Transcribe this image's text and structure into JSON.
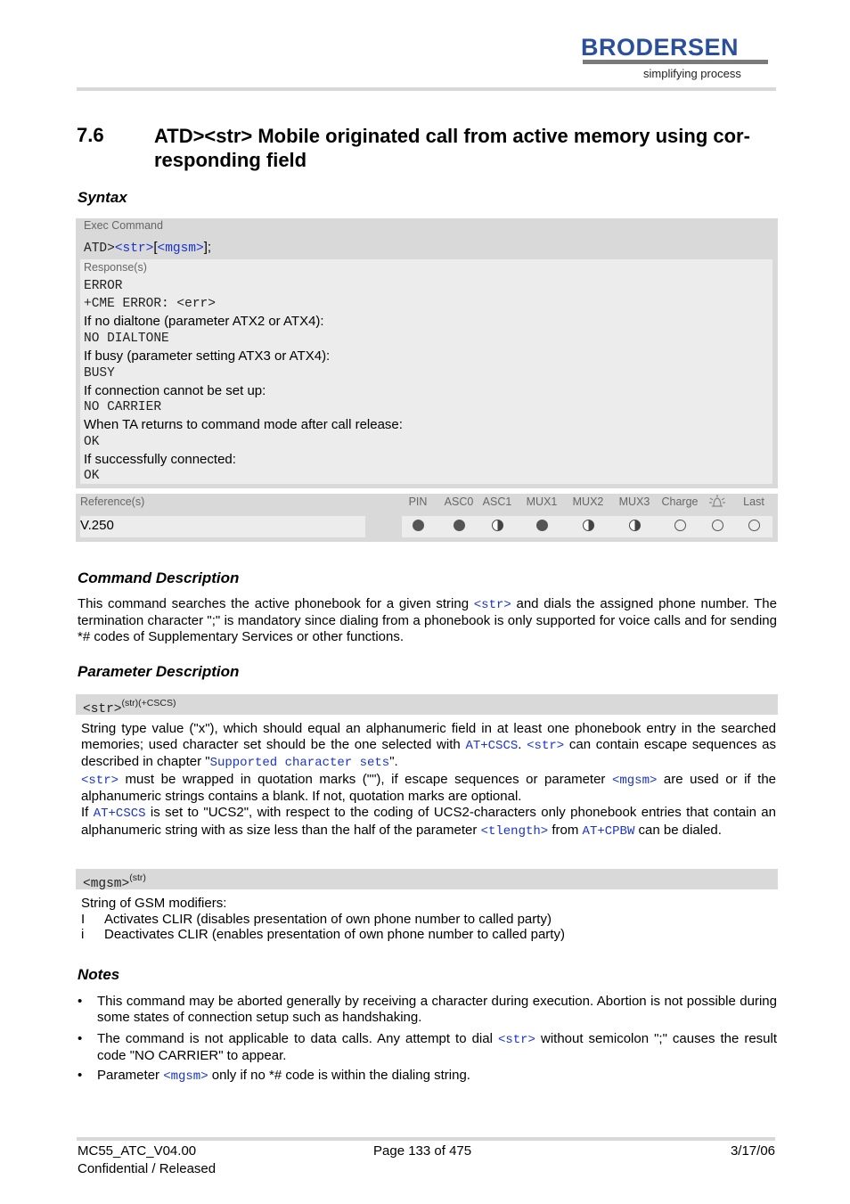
{
  "header": {
    "brand": "BRODERSEN",
    "tagline": "simplifying process"
  },
  "section": {
    "number": "7.6",
    "title": "ATD><str>   Mobile originated call from active memory using cor-responding field"
  },
  "syntax": {
    "heading": "Syntax",
    "exec_label": "Exec Command",
    "command": {
      "prefix": "ATD>",
      "str": "<str>",
      "open": "[",
      "mgsm": "<mgsm>",
      "close": "];"
    },
    "response_label": "Response(s)",
    "responses": [
      {
        "text": "ERROR",
        "mono": true
      },
      {
        "text": "+CME ERROR: <err>",
        "mono": true
      },
      {
        "text": "If no dialtone (parameter ATX2 or ATX4):",
        "mono": false
      },
      {
        "text": "NO DIALTONE",
        "mono": true
      },
      {
        "text": "If busy (parameter setting ATX3 or ATX4):",
        "mono": false
      },
      {
        "text": "BUSY",
        "mono": true
      },
      {
        "text": "If connection cannot be set up:",
        "mono": false
      },
      {
        "text": "NO CARRIER",
        "mono": true
      },
      {
        "text": "When TA returns to command mode after call release:",
        "mono": false
      },
      {
        "text": "OK",
        "mono": true
      },
      {
        "text": "If successfully connected:",
        "mono": false
      },
      {
        "text": "OK",
        "mono": true
      }
    ],
    "reference_label": "Reference(s)",
    "reference_value": "V.250",
    "flags": [
      {
        "label": "PIN",
        "state": "full"
      },
      {
        "label": "ASC0",
        "state": "full"
      },
      {
        "label": "ASC1",
        "state": "half"
      },
      {
        "label": "MUX1",
        "state": "full"
      },
      {
        "label": "MUX2",
        "state": "half"
      },
      {
        "label": "MUX3",
        "state": "half"
      },
      {
        "label": "Charge",
        "state": "empty"
      },
      {
        "label": "alarm-icon",
        "state": "empty"
      },
      {
        "label": "Last",
        "state": "empty"
      }
    ]
  },
  "command_description": {
    "heading": "Command Description",
    "p1a": "This command searches the active phonebook for a given string ",
    "p1_link": "<str>",
    "p1b": " and dials the assigned phone number. The termination character \";\" is mandatory since dialing from a phonebook is only supported for voice calls and for sending *# codes of Supplementary Services or other functions."
  },
  "parameter_description": {
    "heading": "Parameter Description",
    "str_param": {
      "name": "<str>",
      "sup": "(str)(+CSCS)",
      "t1": "String type value (\"x\"), which should equal an alphanumeric field in at least one phonebook entry in the searched memories; used character set should be the one selected with ",
      "l1": "AT+CSCS",
      "t2": ". ",
      "l2": "<str>",
      "t3": " can contain escape sequences as described in chapter \"",
      "l3": "Supported character sets",
      "t4": "\".",
      "l4": "<str>",
      "t5": " must be wrapped in quotation marks (\"\"), if escape sequences or parameter ",
      "l5": "<mgsm>",
      "t6": " are used or if the alphanumeric strings contains a blank. If not, quotation marks are optional.",
      "t7": "If ",
      "l6": "AT+CSCS",
      "t8": " is set to \"UCS2\", with respect to the coding of UCS2-characters only phonebook entries that contain an alphanumeric string with as size less than the half of the parameter ",
      "l7": "<tlength>",
      "t9": " from ",
      "l8": "AT+CPBW",
      "t10": " can be dialed."
    },
    "mgsm_param": {
      "name": "<mgsm>",
      "sup": "(str)",
      "intro": "String of GSM modifiers:",
      "items": [
        {
          "key": "I",
          "desc": "Activates CLIR (disables presentation of own phone number to called party)"
        },
        {
          "key": "i",
          "desc": "Deactivates CLIR (enables presentation of own phone number to called party)"
        }
      ]
    }
  },
  "notes": {
    "heading": "Notes",
    "n1": "This command may be aborted generally by receiving a character during execution. Abortion is not possible during some states of connection setup such as handshaking.",
    "n2a": "The command is not applicable to data calls. Any attempt to dial ",
    "n2_link": "<str>",
    "n2b": " without semicolon \";\" causes the result code \"NO CARRIER\" to appear.",
    "n3a": "Parameter ",
    "n3_link": "<mgsm>",
    "n3b": " only if no *# code is within the dialing string."
  },
  "footer": {
    "doc_id": "MC55_ATC_V04.00",
    "page": "Page 133 of 475",
    "date": "3/17/06",
    "status": "Confidential / Released"
  }
}
